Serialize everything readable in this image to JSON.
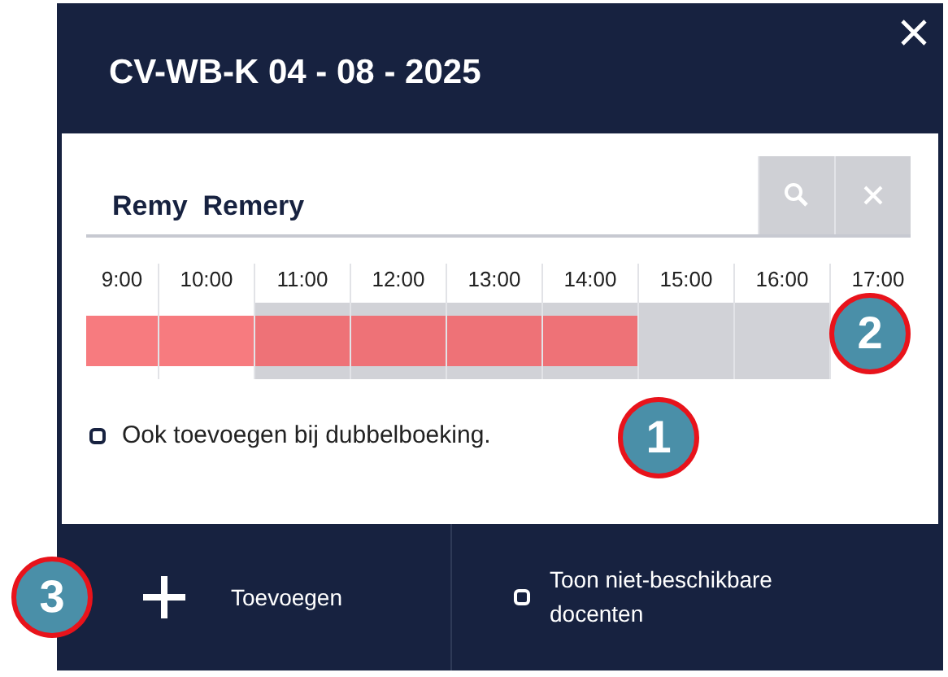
{
  "dialog": {
    "title": "CV-WB-K 04 - 08 - 2025"
  },
  "search": {
    "value": "Remy  Remery"
  },
  "timeline": {
    "hours": [
      {
        "label": "9:00",
        "available": false,
        "booked": true
      },
      {
        "label": "10:00",
        "available": false,
        "booked": true
      },
      {
        "label": "11:00",
        "available": true,
        "booked": true
      },
      {
        "label": "12:00",
        "available": true,
        "booked": true
      },
      {
        "label": "13:00",
        "available": true,
        "booked": true
      },
      {
        "label": "14:00",
        "available": true,
        "booked": true
      },
      {
        "label": "15:00",
        "available": true,
        "booked": false
      },
      {
        "label": "16:00",
        "available": true,
        "booked": false
      },
      {
        "label": "17:00",
        "available": false,
        "booked": false
      }
    ]
  },
  "double_booking": {
    "label": "Ook toevoegen bij dubbelboeking.",
    "checked": false
  },
  "footer": {
    "add_button": "Toevoegen",
    "show_unavailable": {
      "label": "Toon niet-beschikbare docenten",
      "checked": false
    }
  },
  "callouts": [
    {
      "label": "1"
    },
    {
      "label": "2"
    },
    {
      "label": "3"
    }
  ]
}
